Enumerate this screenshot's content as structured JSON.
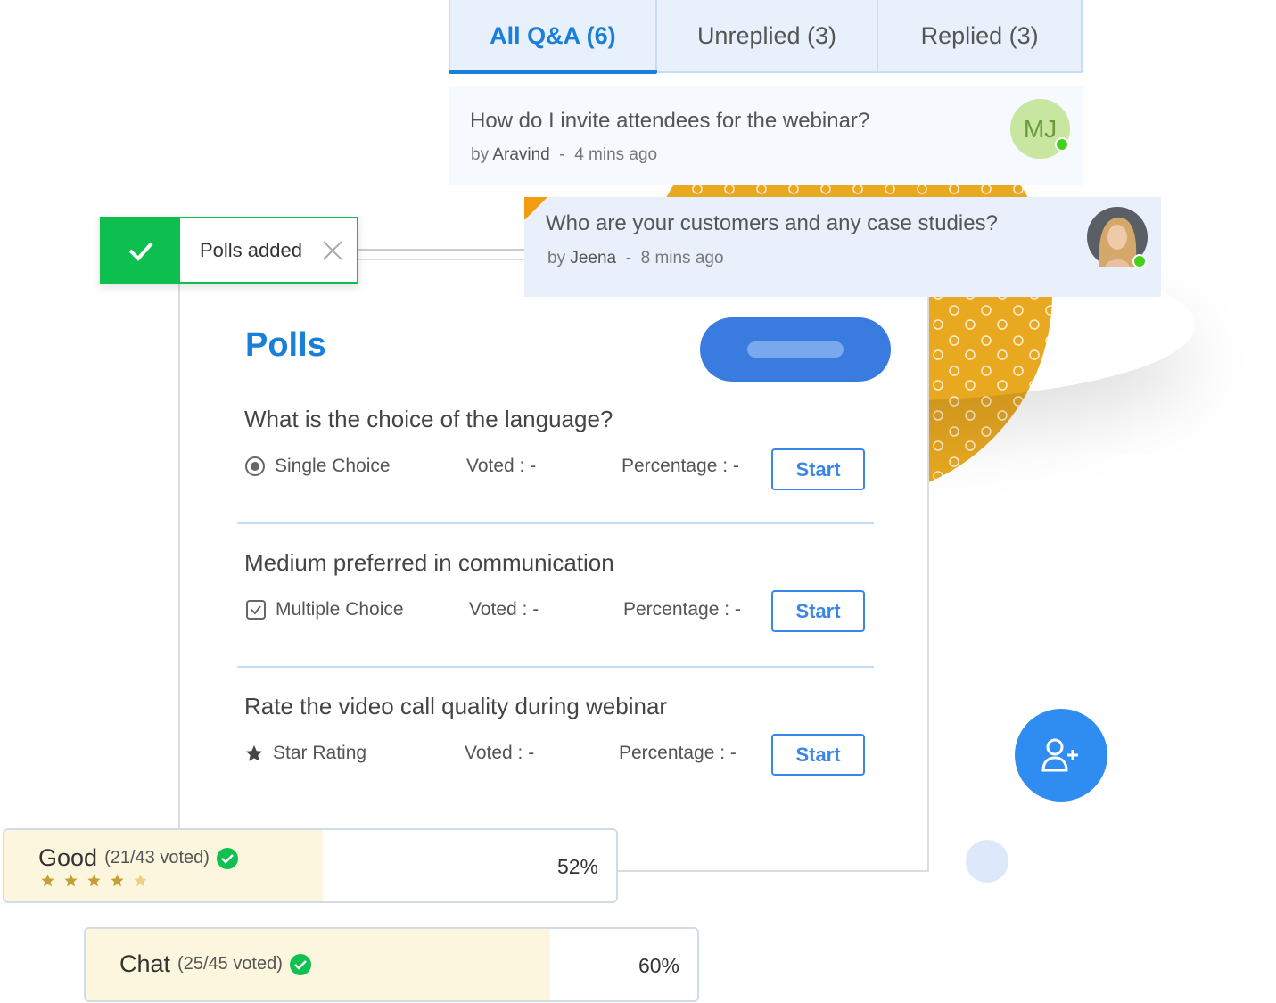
{
  "tabs": [
    {
      "label": "All Q&A (6)",
      "active": true
    },
    {
      "label": "Unreplied (3)"
    },
    {
      "label": "Replied (3)"
    }
  ],
  "questions": [
    {
      "text": "How do I invite attendees for the webinar?",
      "by": "by",
      "author": "Aravind",
      "time": "4 mins ago",
      "avatar_initials": "MJ",
      "online": true
    },
    {
      "text": "Who are your customers and any case studies?",
      "by": "by",
      "author": "Jeena",
      "time": "8 mins ago",
      "avatar": "photo",
      "online": true
    }
  ],
  "toast": {
    "message": "Polls added",
    "icon": "check-icon",
    "close_icon": "close-icon"
  },
  "polls": {
    "title": "Polls",
    "items": [
      {
        "question": "What is the choice of the language?",
        "type": "Single Choice",
        "type_icon": "radio-icon",
        "voted": "Voted : -",
        "percentage": "Percentage : -",
        "action": "Start"
      },
      {
        "question": "Medium preferred in communication",
        "type": "Multiple Choice",
        "type_icon": "checkbox-icon",
        "voted": "Voted : -",
        "percentage": "Percentage : -",
        "action": "Start"
      },
      {
        "question": "Rate the video call quality during webinar",
        "type": "Star Rating",
        "type_icon": "star-icon",
        "voted": "Voted : -",
        "percentage": "Percentage : -",
        "action": "Start"
      }
    ]
  },
  "results": [
    {
      "label": "Good",
      "votes": "(21/43 voted)",
      "percent": "52%",
      "stars": 4,
      "max_stars": 5
    },
    {
      "label": "Chat",
      "votes": "(25/45 voted)",
      "percent": "60%"
    }
  ],
  "colors": {
    "accent": "#1a7fd9",
    "success": "#0cbf4f",
    "highlight": "#e8a820",
    "fab": "#2f8cf0"
  }
}
